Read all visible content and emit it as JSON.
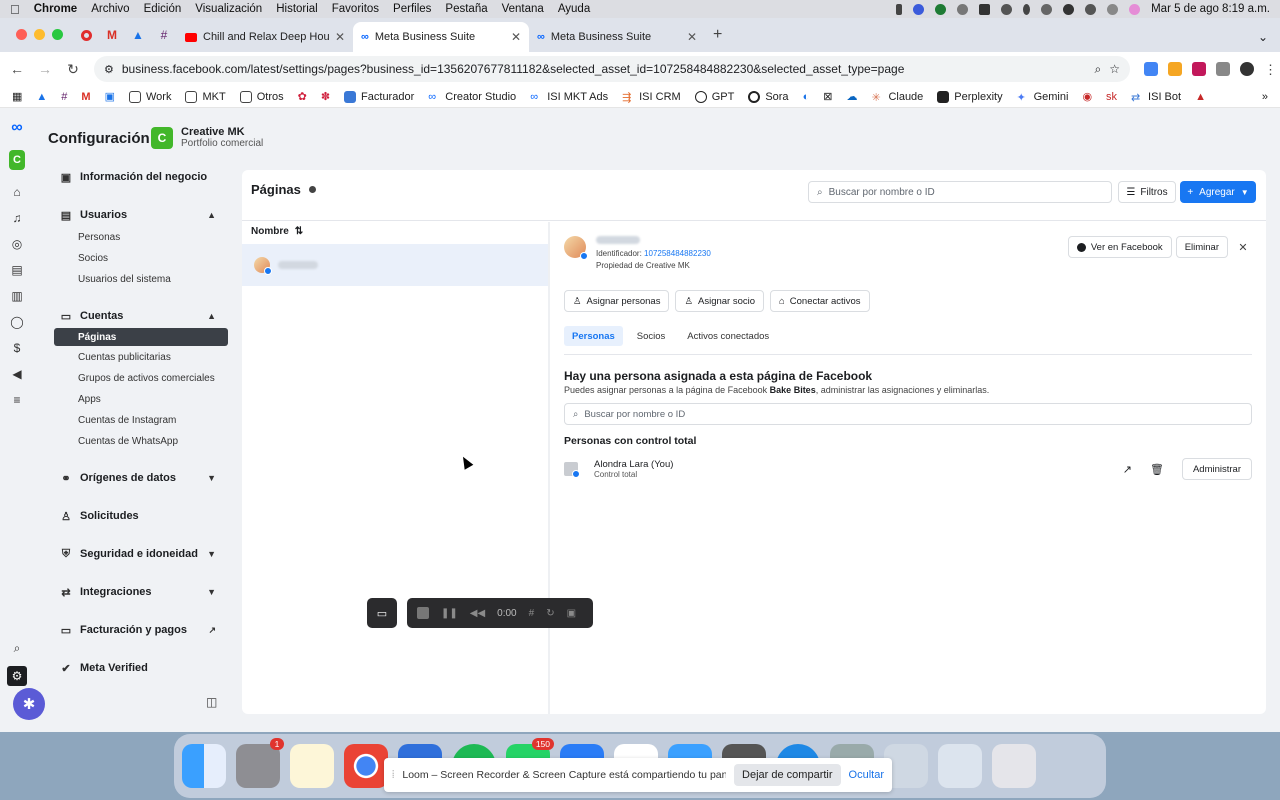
{
  "mac_menu": {
    "app": "Chrome",
    "items": [
      "Archivo",
      "Edición",
      "Visualización",
      "Historial",
      "Favoritos",
      "Perfiles",
      "Pestaña",
      "Ventana",
      "Ayuda"
    ],
    "datetime": "Mar 5 de ago 8:19 a.m."
  },
  "tabs": [
    {
      "title": "Chill and Relax Deep House S",
      "active": false
    },
    {
      "title": "Meta Business Suite",
      "active": true
    },
    {
      "title": "Meta Business Suite",
      "active": false
    }
  ],
  "address": {
    "url": "business.facebook.com/latest/settings/pages?business_id=1356207677811182&selected_asset_id=107258484882230&selected_asset_type=page"
  },
  "bookmarks": [
    "Work",
    "MKT",
    "Otros",
    "Facturador",
    "Creator Studio",
    "ISI MKT Ads",
    "ISI CRM",
    "GPT",
    "Sora",
    "Claude",
    "Perplexity",
    "Gemini",
    "ISI Bot"
  ],
  "app": {
    "title": "Configuración",
    "portfolio": {
      "initial": "C",
      "name": "Creative MK",
      "type": "Portfolio comercial"
    },
    "rail_initial": "C"
  },
  "sidebar": {
    "info": "Información del negocio",
    "usuarios": {
      "label": "Usuarios",
      "items": [
        "Personas",
        "Socios",
        "Usuarios del sistema"
      ]
    },
    "cuentas": {
      "label": "Cuentas",
      "items": [
        "Páginas",
        "Cuentas publicitarias",
        "Grupos de activos comerciales",
        "Apps",
        "Cuentas de Instagram",
        "Cuentas de WhatsApp"
      ]
    },
    "origenes": "Orígenes de datos",
    "solicitudes": "Solicitudes",
    "seguridad": "Seguridad e idoneidad d...",
    "integraciones": "Integraciones",
    "facturacion": "Facturación y pagos",
    "verified": "Meta Verified"
  },
  "pages": {
    "title": "Páginas",
    "search_placeholder": "Buscar por nombre o ID",
    "filters": "Filtros",
    "add": "Agregar",
    "column": "Nombre"
  },
  "detail": {
    "id_label": "Identificador:",
    "id_value": "107258484882230",
    "owner": "Propiedad de Creative MK",
    "view_fb": "Ver en Facebook",
    "delete": "Eliminar",
    "assign_people": "Asignar personas",
    "assign_partner": "Asignar socio",
    "connect_assets": "Conectar activos",
    "tabs": [
      "Personas",
      "Socios",
      "Activos conectados"
    ],
    "heading": "Hay una persona asignada a esta página de Facebook",
    "sub_pre": "Puedes asignar personas a la página de Facebook",
    "sub_bold": "Bake Bites",
    "sub_post": ", administrar las asignaciones y eliminarlas.",
    "search_placeholder": "Buscar por nombre o ID",
    "section": "Personas con control total",
    "person": {
      "name": "Alondra Lara (You)",
      "role": "Control total"
    },
    "manage": "Administrar"
  },
  "recorder": {
    "time": "0:00"
  },
  "dock": {
    "settings_badge": "1",
    "whatsapp_badge": "150"
  },
  "loom": {
    "message": "Loom – Screen Recorder & Screen Capture está compartiendo tu pantalla.",
    "stop": "Dejar de compartir",
    "hide": "Ocultar"
  }
}
